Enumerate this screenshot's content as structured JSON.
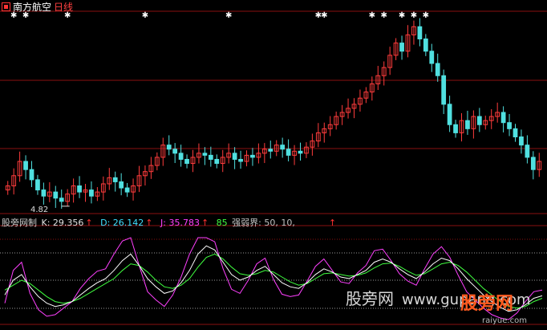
{
  "header": {
    "stock_name": "南方航空",
    "period": "日线"
  },
  "price_panel": {
    "min_label": "4.82",
    "marker_icon": "star-icon"
  },
  "indicator": {
    "name": "股旁网制",
    "k_label": "K: 29.356",
    "d_label": "D: 26.142",
    "j_label": "J: 35.783",
    "level_label": "85",
    "strength_label": "强弱界: 50, 10,",
    "arrow": "↑"
  },
  "watermark": {
    "text": "股旁网",
    "url": "www.gupang.com",
    "brand": "股旁网",
    "brand_url": "raiyue.com"
  },
  "colors": {
    "up_candle": "#ff3c3c",
    "down_candle": "#50e0e0",
    "grid": "#8a1010",
    "k_line": "#ffffff",
    "d_line": "#40ff40",
    "j_line": "#ff40ff",
    "background": "#000000"
  },
  "chart_data": {
    "type": "candlestick",
    "price_min": 4.82,
    "closes": [
      5.2,
      5.45,
      5.8,
      5.6,
      5.35,
      5.1,
      4.95,
      5.05,
      4.9,
      4.82,
      5.0,
      5.2,
      5.05,
      5.1,
      4.95,
      5.05,
      5.25,
      5.4,
      5.3,
      5.15,
      5.05,
      5.2,
      5.45,
      5.55,
      5.7,
      5.9,
      6.2,
      6.1,
      6.0,
      5.85,
      5.75,
      5.9,
      6.0,
      5.95,
      5.85,
      5.75,
      5.9,
      6.0,
      5.85,
      5.8,
      5.95,
      5.9,
      6.0,
      6.1,
      6.05,
      6.2,
      6.1,
      5.95,
      6.05,
      6.0,
      6.15,
      6.3,
      6.5,
      6.6,
      6.7,
      6.9,
      7.0,
      7.1,
      7.2,
      7.35,
      7.5,
      7.7,
      7.9,
      8.1,
      8.4,
      8.7,
      8.5,
      8.9,
      9.1,
      8.8,
      8.5,
      8.2,
      7.9,
      7.2,
      6.7,
      6.5,
      6.8,
      6.6,
      6.9,
      6.7,
      6.8,
      6.9,
      7.0,
      6.75,
      6.6,
      6.4,
      6.2,
      5.9,
      5.6,
      5.8
    ],
    "stars_at": [
      1,
      3,
      10,
      23,
      37,
      52,
      53,
      61,
      63,
      66,
      68,
      70
    ],
    "indicator_levels": [
      50,
      10,
      85
    ],
    "k": [
      30,
      48,
      55,
      40,
      28,
      20,
      16,
      18,
      22,
      30,
      38,
      45,
      50,
      60,
      72,
      80,
      66,
      50,
      40,
      32,
      35,
      45,
      60,
      80,
      90,
      85,
      70,
      55,
      48,
      52,
      60,
      65,
      55,
      45,
      40,
      38,
      45,
      55,
      62,
      58,
      52,
      50,
      55,
      60,
      70,
      74,
      70,
      62,
      55,
      50,
      58,
      68,
      75,
      72,
      62,
      50,
      40,
      30,
      22,
      15,
      10,
      12,
      18,
      26,
      29
    ],
    "d": [
      36,
      42,
      48,
      44,
      36,
      28,
      22,
      20,
      22,
      26,
      32,
      38,
      44,
      50,
      60,
      68,
      66,
      58,
      48,
      40,
      38,
      42,
      50,
      64,
      76,
      80,
      74,
      64,
      56,
      54,
      56,
      60,
      58,
      52,
      46,
      42,
      44,
      50,
      56,
      57,
      55,
      53,
      54,
      57,
      63,
      68,
      69,
      65,
      59,
      54,
      56,
      62,
      68,
      70,
      66,
      58,
      48,
      38,
      30,
      22,
      16,
      14,
      16,
      22,
      26
    ],
    "j": [
      20,
      60,
      70,
      32,
      12,
      4,
      6,
      14,
      22,
      38,
      50,
      59,
      62,
      80,
      96,
      100,
      66,
      34,
      24,
      16,
      30,
      52,
      80,
      100,
      100,
      95,
      62,
      37,
      32,
      48,
      68,
      75,
      49,
      31,
      28,
      30,
      47,
      65,
      74,
      60,
      46,
      44,
      57,
      66,
      84,
      86,
      72,
      56,
      47,
      42,
      62,
      80,
      89,
      76,
      54,
      34,
      24,
      14,
      6,
      2,
      0,
      8,
      22,
      34,
      36
    ]
  }
}
